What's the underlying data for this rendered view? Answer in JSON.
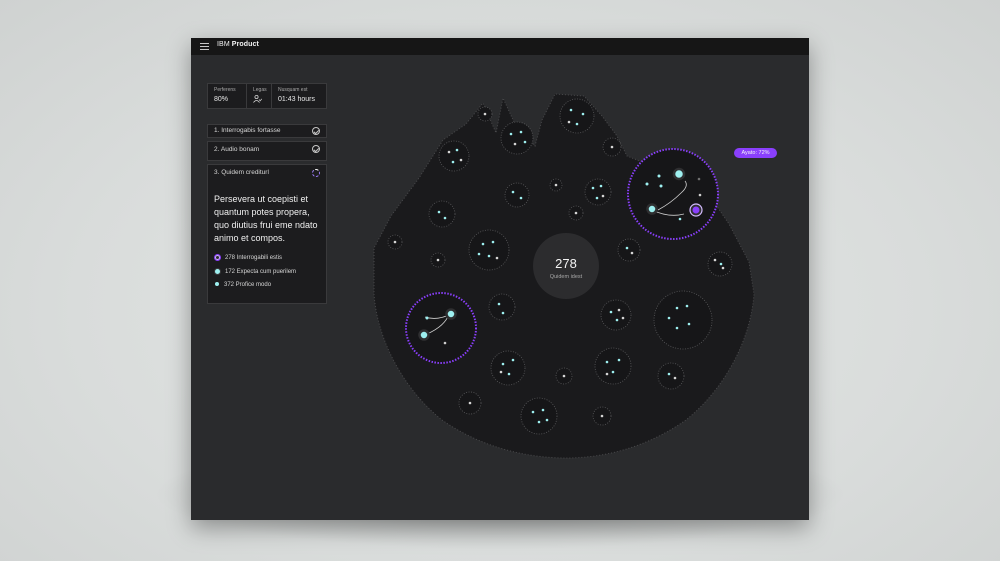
{
  "header": {
    "brand_prefix": "IBM",
    "brand_name": "Product"
  },
  "stats": [
    {
      "label": "Perferens",
      "value": "80%"
    },
    {
      "label": "Legas",
      "value": "",
      "icon": "person-icon"
    },
    {
      "label": "Nusquam est",
      "value": "01:43 hours"
    }
  ],
  "steps": [
    {
      "label": "1.  Interrogabis fortasse",
      "status": "complete"
    },
    {
      "label": "2. Audio bonam",
      "status": "complete"
    },
    {
      "label": "3. Quidem crediturl",
      "status": "in-progress"
    }
  ],
  "description": "Persevera ut coepisti et quantum potes propera, quo diutius frui eme ndato animo et compos.",
  "legend": [
    {
      "label": "278 Interrogabili estis",
      "color": "#8a3ffc"
    },
    {
      "label": "172 Expecta cum puerilem",
      "color": "#9ef0f0"
    },
    {
      "label": "372 Profice modo",
      "color": "#9ef0f0"
    }
  ],
  "center": {
    "value": "278",
    "label": "Quidem idest"
  },
  "tag": {
    "label": "Ayato: 72%"
  },
  "colors": {
    "accent": "#8a3ffc",
    "node": "#9ef0f0",
    "bubble": "#161618",
    "surface": "#1c1c1e"
  }
}
